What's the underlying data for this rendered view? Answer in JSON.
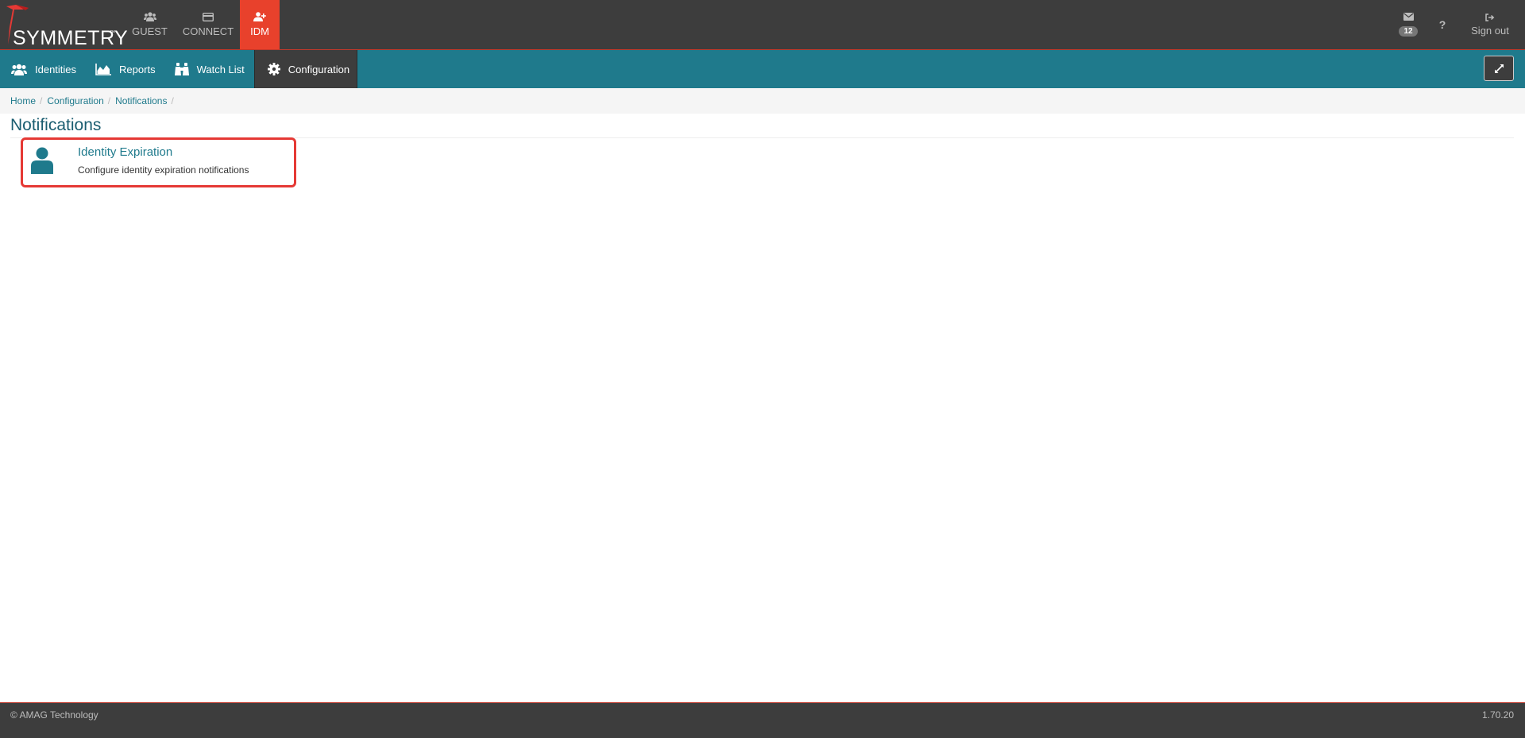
{
  "brand": {
    "name": "SYMMETRY",
    "tm": "™"
  },
  "apps": [
    {
      "label": "GUEST",
      "icon": "users-icon"
    },
    {
      "label": "CONNECT",
      "icon": "credit-card-icon"
    },
    {
      "label": "IDM",
      "icon": "user-plus-icon",
      "active": true
    }
  ],
  "topright": {
    "mail_count": "12",
    "help_label": "?",
    "signout_label": "Sign out"
  },
  "mainnav": [
    {
      "label": "Identities",
      "icon": "users-icon"
    },
    {
      "label": "Reports",
      "icon": "area-chart-icon"
    },
    {
      "label": "Watch List",
      "icon": "binoculars-icon"
    },
    {
      "label": "Configuration",
      "icon": "gear-icon",
      "active": true
    }
  ],
  "breadcrumb": [
    "Home",
    "Configuration",
    "Notifications"
  ],
  "page": {
    "title": "Notifications",
    "card": {
      "title": "Identity Expiration",
      "description": "Configure identity expiration notifications",
      "icon": "user-icon"
    }
  },
  "footer": {
    "copyright": "© AMAG Technology",
    "version": "1.70.20"
  },
  "colors": {
    "topbar": "#3d3d3d",
    "accent_red": "#e8412c",
    "teal": "#1f7a8c",
    "highlight_border": "#e53935"
  }
}
